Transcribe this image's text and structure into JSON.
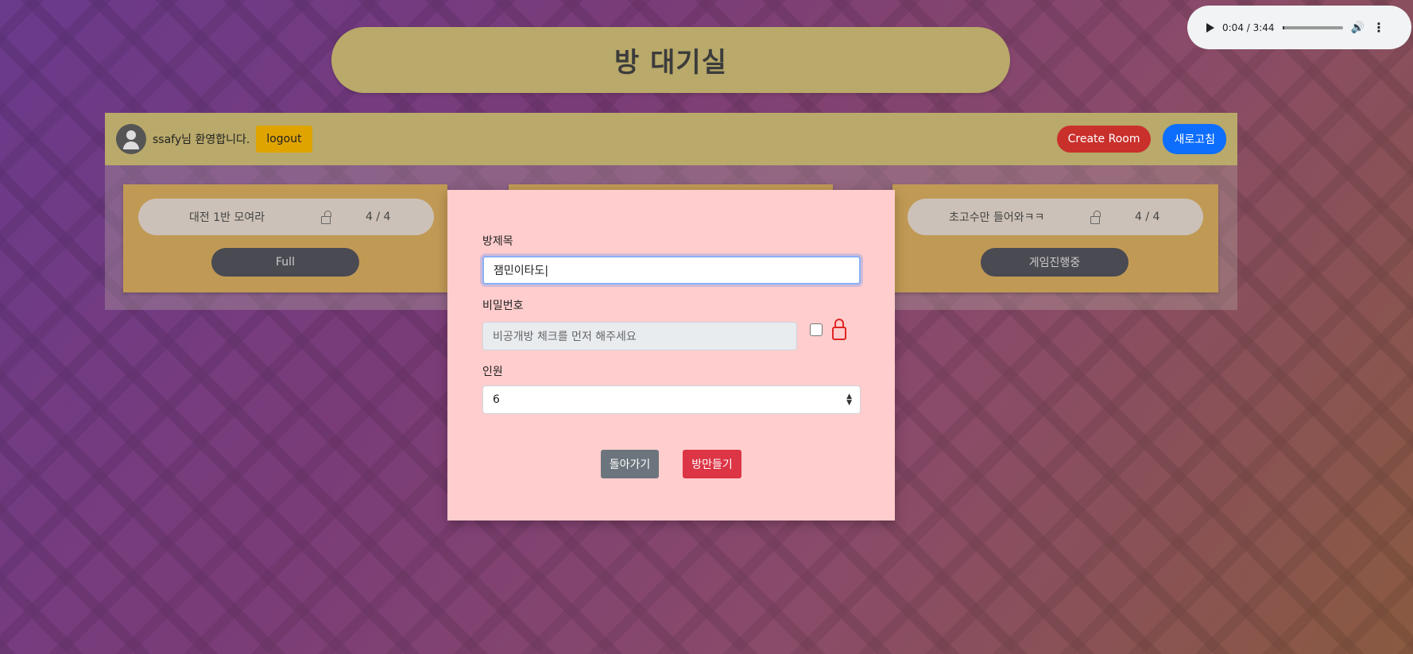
{
  "page_title": "방 대기실",
  "audio": {
    "time": "0:04 / 3:44",
    "play_icon": "play-icon",
    "volume_icon": "volume-icon",
    "more_icon": "more-vert-icon"
  },
  "user": {
    "welcome": "ssafy님 환영합니다.",
    "logout_label": "logout"
  },
  "toolbar": {
    "create_label": "Create Room",
    "refresh_label": "새로고침"
  },
  "rooms": [
    {
      "name": "대전 1반 모여라",
      "count": "4 / 4",
      "status": "Full"
    },
    {
      "name": "",
      "count": "",
      "status": ""
    },
    {
      "name": "초고수만 들어와ㅋㅋ",
      "count": "4 / 4",
      "status": "게임진행중"
    }
  ],
  "modal": {
    "title_label": "방제목",
    "title_value": "잼민이타도|",
    "password_label": "비밀번호",
    "password_placeholder": "비공개방 체크를 먼저 해주세요",
    "players_label": "인원",
    "players_value": "6",
    "back_label": "돌아가기",
    "create_label": "방만들기"
  }
}
